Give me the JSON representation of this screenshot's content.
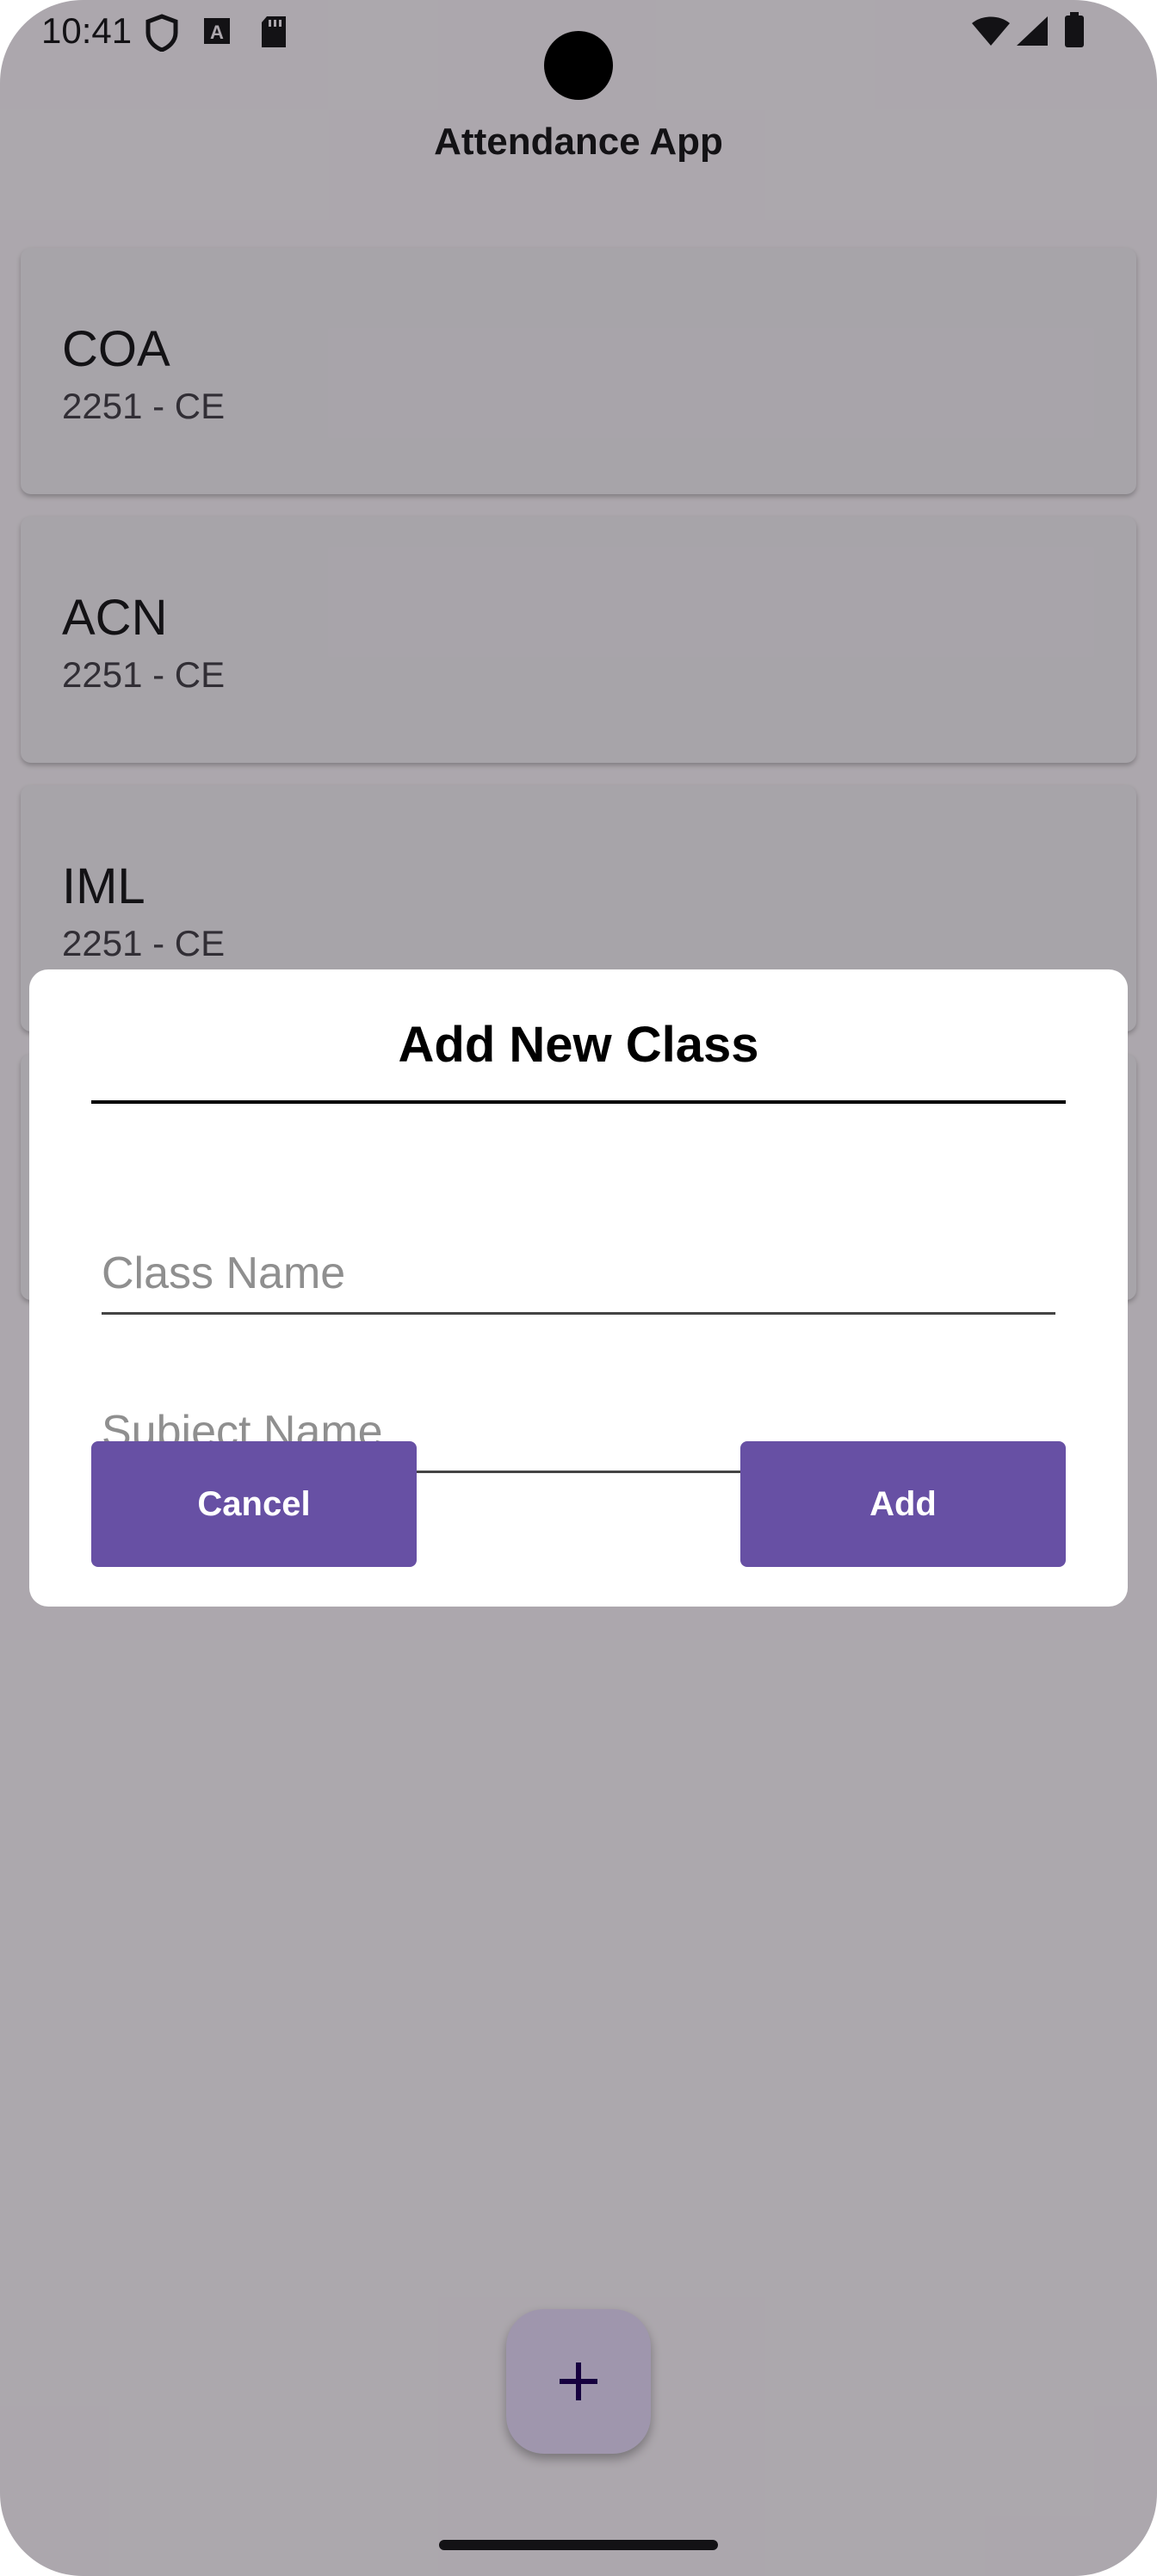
{
  "status_bar": {
    "time": "10:41",
    "icons_left": [
      "shield-icon",
      "font-a-icon",
      "sd-card-icon"
    ],
    "icons_right": [
      "wifi-icon",
      "signal-icon",
      "battery-icon"
    ]
  },
  "app": {
    "title": "Attendance App"
  },
  "classes": [
    {
      "name": "COA",
      "detail": "2251 - CE"
    },
    {
      "name": "ACN",
      "detail": "2251 - CE"
    },
    {
      "name": "IML",
      "detail": "2251 - CE"
    }
  ],
  "dialog": {
    "title": "Add New Class",
    "class_name_placeholder": "Class Name",
    "class_name_value": "",
    "subject_name_placeholder": "Subject Name",
    "subject_name_value": "",
    "cancel_label": "Cancel",
    "add_label": "Add"
  },
  "fab": {
    "icon": "plus-icon"
  },
  "colors": {
    "primary": "#6750a4",
    "fab_container": "#eaddff",
    "scrim": "rgba(0,0,0,0.32)"
  }
}
